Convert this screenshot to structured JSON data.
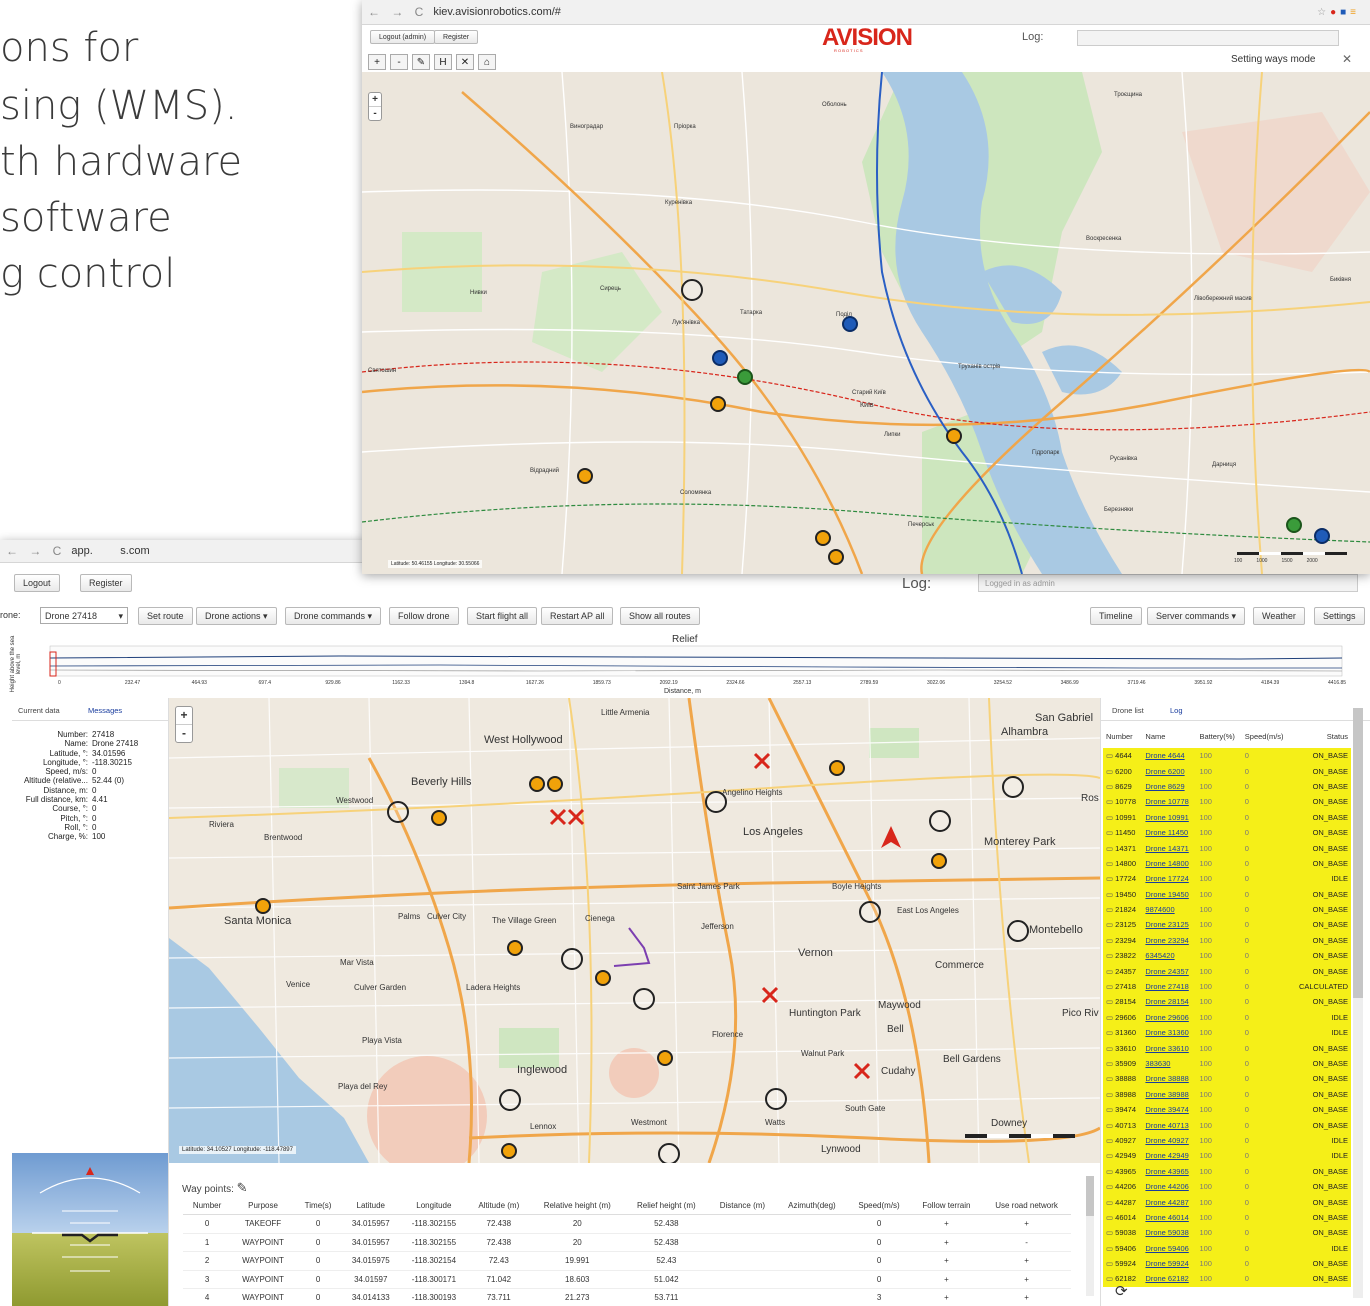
{
  "slide_text": [
    "ons for",
    "sing (WMS).",
    "th hardware",
    "software",
    "g control"
  ],
  "top_window": {
    "url": "kiev.avisionrobotics.com/#",
    "buttons": {
      "logout": "Logout (admin)",
      "register": "Register"
    },
    "brand": "AVISION",
    "brand_sub": "R O B O T I C S",
    "log_label": "Log:",
    "mode_label": "Setting ways mode",
    "close_glyph": "✕",
    "toolbar": [
      "+",
      "-",
      "✎",
      "H",
      "✕",
      "⌂"
    ],
    "zoom": [
      "+",
      "-"
    ],
    "coords": "Latitude: 50.46155 Longitude: 30.55066",
    "labels": [
      "Оболонь",
      "Виноградар",
      "Пріорка",
      "Куренівка",
      "Сирець",
      "Лук'янівка",
      "Татарка",
      "Поділ",
      "Київ",
      "Старий Київ",
      "Липки",
      "Печерськ",
      "Русанівка",
      "Дарниця",
      "Березняки",
      "Лівобережний масив",
      "Воскресенка",
      "Биківня",
      "Соломянка",
      "Відрадний",
      "Святошин",
      "Нивки",
      "Труханів острів",
      "Гідропарк",
      "Троєщина"
    ],
    "scale": [
      "100",
      "1000",
      "1500",
      "2000"
    ]
  },
  "bottom_window": {
    "url_left": "app.",
    "url_right": "s.com",
    "buttons": {
      "logout": "Logout",
      "register": "Register"
    },
    "log_label": "Log:",
    "log_value": "Logged in as admin",
    "drone_label": "rone:",
    "drone_value": "Drone 27418",
    "toolbar": {
      "set_route": "Set route",
      "drone_actions": "Drone actions ▾",
      "drone_commands": "Drone commands ▾",
      "follow_drone": "Follow drone",
      "start_flight_all": "Start flight all",
      "restart_ap_all": "Restart AP all",
      "show_all_routes": "Show all routes",
      "timeline": "Timeline",
      "server_commands": "Server commands ▾",
      "weather": "Weather",
      "settings": "Settings"
    },
    "relief": {
      "title": "Relief",
      "ylabel": "Height above the sea level, m",
      "xlabel": "Distance, m",
      "ticks": [
        "0",
        "232.47",
        "464.93",
        "697.4",
        "929.86",
        "1162.33",
        "1394.8",
        "1627.26",
        "1859.73",
        "2092.19",
        "2324.66",
        "2557.13",
        "2789.59",
        "3022.06",
        "3254.52",
        "3486.99",
        "3719.46",
        "3951.92",
        "4184.39",
        "4416.85"
      ]
    },
    "left_tabs": {
      "current": "Current data",
      "messages": "Messages"
    },
    "current_data": [
      {
        "k": "Number:",
        "v": "27418"
      },
      {
        "k": "Name:",
        "v": "Drone 27418"
      },
      {
        "k": "Latitude, °:",
        "v": "34.01596"
      },
      {
        "k": "Longitude, °:",
        "v": "-118.30215"
      },
      {
        "k": "Speed, m/s:",
        "v": "0"
      },
      {
        "k": "Altitude (relative...",
        "v": "52.44 (0)"
      },
      {
        "k": "Distance, m:",
        "v": "0"
      },
      {
        "k": "Full distance, km:",
        "v": "4.41"
      },
      {
        "k": "Course, °:",
        "v": "0"
      },
      {
        "k": "Pitch, °:",
        "v": "0"
      },
      {
        "k": "Roll, °:",
        "v": "0"
      },
      {
        "k": "Charge, %:",
        "v": "100"
      }
    ],
    "map": {
      "zoom": [
        "+",
        "-"
      ],
      "coords": "Latitude: 34.10527 Longitude: -118.47897",
      "labels": [
        "Little Armenia",
        "West Hollywood",
        "Beverly Hills",
        "Westwood",
        "Riviera",
        "Brentwood",
        "Angelino Heights",
        "Los Angeles",
        "Alhambra",
        "San Gabriel",
        "Monterey Park",
        "Santa Monica",
        "Palms",
        "Culver City",
        "The Village Green",
        "Cienega",
        "Jefferson",
        "Saint James Park",
        "Boyle Heights",
        "East Los Angeles",
        "Montebello",
        "Mar Vista",
        "Venice",
        "Culver Garden",
        "Ladera Heights",
        "Vernon",
        "Commerce",
        "Huntington Park",
        "Maywood",
        "Bell",
        "Pico Riv",
        "Playa Vista",
        "Playa del Rey",
        "Inglewood",
        "Florence",
        "Walnut Park",
        "Cudahy",
        "Bell Gardens",
        "South Gate",
        "Westmont",
        "Lennox",
        "Watts",
        "Downey",
        "Lynwood",
        "Ros"
      ]
    },
    "waypoints": {
      "title": "Way points:",
      "columns": [
        "Number",
        "Purpose",
        "Time(s)",
        "Latitude",
        "Longitude",
        "Altitude (m)",
        "Relative height (m)",
        "Relief height (m)",
        "Distance (m)",
        "Azimuth(deg)",
        "Speed(m/s)",
        "Follow terrain",
        "Use road network"
      ],
      "rows": [
        [
          "0",
          "TAKEOFF",
          "0",
          "34.015957",
          "-118.302155",
          "72.438",
          "20",
          "52.438",
          "",
          "",
          "0",
          "+",
          "+"
        ],
        [
          "1",
          "WAYPOINT",
          "0",
          "34.015957",
          "-118.302155",
          "72.438",
          "20",
          "52.438",
          "",
          "",
          "0",
          "+",
          "-"
        ],
        [
          "2",
          "WAYPOINT",
          "0",
          "34.015975",
          "-118.302154",
          "72.43",
          "19.991",
          "52.43",
          "",
          "",
          "0",
          "+",
          "+"
        ],
        [
          "3",
          "WAYPOINT",
          "0",
          "34.01597",
          "-118.300171",
          "71.042",
          "18.603",
          "51.042",
          "",
          "",
          "0",
          "+",
          "+"
        ],
        [
          "4",
          "WAYPOINT",
          "0",
          "34.014133",
          "-118.300193",
          "73.711",
          "21.273",
          "53.711",
          "",
          "",
          "3",
          "+",
          "+"
        ]
      ]
    },
    "right_tabs": {
      "drone_list": "Drone list",
      "log": "Log"
    },
    "drone_list": {
      "columns": [
        "Number",
        "Name",
        "Battery(%)",
        "Speed(m/s)",
        "Status"
      ],
      "rows": [
        [
          "4644",
          "Drone 4644",
          "100",
          "0",
          "ON_BASE"
        ],
        [
          "6200",
          "Drone 6200",
          "100",
          "0",
          "ON_BASE"
        ],
        [
          "8629",
          "Drone 8629",
          "100",
          "0",
          "ON_BASE"
        ],
        [
          "10778",
          "Drone 10778",
          "100",
          "0",
          "ON_BASE"
        ],
        [
          "10991",
          "Drone 10991",
          "100",
          "0",
          "ON_BASE"
        ],
        [
          "11450",
          "Drone 11450",
          "100",
          "0",
          "ON_BASE"
        ],
        [
          "14371",
          "Drone 14371",
          "100",
          "0",
          "ON_BASE"
        ],
        [
          "14800",
          "Drone 14800",
          "100",
          "0",
          "ON_BASE"
        ],
        [
          "17724",
          "Drone 17724",
          "100",
          "0",
          "IDLE"
        ],
        [
          "19450",
          "Drone 19450",
          "100",
          "0",
          "ON_BASE"
        ],
        [
          "21824",
          "9874600",
          "100",
          "0",
          "ON_BASE"
        ],
        [
          "23125",
          "Drone 23125",
          "100",
          "0",
          "ON_BASE"
        ],
        [
          "23294",
          "Drone 23294",
          "100",
          "0",
          "ON_BASE"
        ],
        [
          "23822",
          "6345420",
          "100",
          "0",
          "ON_BASE"
        ],
        [
          "24357",
          "Drone 24357",
          "100",
          "0",
          "ON_BASE"
        ],
        [
          "27418",
          "Drone 27418",
          "100",
          "0",
          "CALCULATED"
        ],
        [
          "28154",
          "Drone 28154",
          "100",
          "0",
          "ON_BASE"
        ],
        [
          "29606",
          "Drone 29606",
          "100",
          "0",
          "IDLE"
        ],
        [
          "31360",
          "Drone 31360",
          "100",
          "0",
          "IDLE"
        ],
        [
          "33610",
          "Drone 33610",
          "100",
          "0",
          "ON_BASE"
        ],
        [
          "35909",
          "383630",
          "100",
          "0",
          "ON_BASE"
        ],
        [
          "38888",
          "Drone 38888",
          "100",
          "0",
          "ON_BASE"
        ],
        [
          "38988",
          "Drone 38988",
          "100",
          "0",
          "ON_BASE"
        ],
        [
          "39474",
          "Drone 39474",
          "100",
          "0",
          "ON_BASE"
        ],
        [
          "40713",
          "Drone 40713",
          "100",
          "0",
          "ON_BASE"
        ],
        [
          "40927",
          "Drone 40927",
          "100",
          "0",
          "IDLE"
        ],
        [
          "42949",
          "Drone 42949",
          "100",
          "0",
          "IDLE"
        ],
        [
          "43965",
          "Drone 43965",
          "100",
          "0",
          "ON_BASE"
        ],
        [
          "44206",
          "Drone 44206",
          "100",
          "0",
          "ON_BASE"
        ],
        [
          "44287",
          "Drone 44287",
          "100",
          "0",
          "ON_BASE"
        ],
        [
          "46014",
          "Drone 46014",
          "100",
          "0",
          "ON_BASE"
        ],
        [
          "59038",
          "Drone 59038",
          "100",
          "0",
          "ON_BASE"
        ],
        [
          "59406",
          "Drone 59406",
          "100",
          "0",
          "IDLE"
        ],
        [
          "59924",
          "Drone 59924",
          "100",
          "0",
          "ON_BASE"
        ],
        [
          "62182",
          "Drone 62182",
          "100",
          "0",
          "ON_BASE"
        ]
      ]
    },
    "colors": {
      "accent_red": "#d8261b",
      "list_highlight": "#f5ef18",
      "route_blue": "#2a5fc4"
    }
  }
}
